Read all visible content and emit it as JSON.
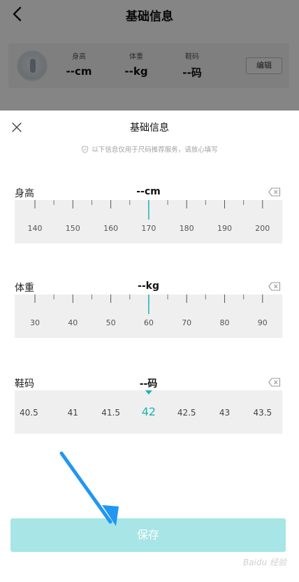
{
  "background_page": {
    "title": "基础信息",
    "stats": [
      {
        "label": "身高",
        "value": "--cm"
      },
      {
        "label": "体重",
        "value": "--kg"
      },
      {
        "label": "鞋码",
        "value": "--码"
      }
    ],
    "edit_label": "编辑"
  },
  "sheet": {
    "title": "基础信息",
    "notice": "以下信息仅用于尺码推荐服务，请放心填写",
    "fields": [
      {
        "label": "身高",
        "value": "--cm",
        "scale": [
          "140",
          "150",
          "160",
          "170",
          "180",
          "190",
          "200"
        ],
        "selected": "170"
      },
      {
        "label": "体重",
        "value": "--kg",
        "scale": [
          "30",
          "40",
          "50",
          "60",
          "70",
          "80",
          "90"
        ],
        "selected": "60"
      },
      {
        "label": "鞋码",
        "value": "--码",
        "scale": [
          "40.5",
          "41",
          "41.5",
          "42",
          "42.5",
          "43",
          "43.5"
        ],
        "selected": "42"
      }
    ],
    "save_label": "保存"
  },
  "watermark": "Baidu 经验",
  "colors": {
    "accent": "#20b2b4",
    "save_button": "#a7e5e6",
    "arrow": "#2196f3"
  },
  "icons": {
    "back": "chevron-left-icon",
    "close": "close-icon",
    "clear": "backspace-icon",
    "notice": "shield-icon"
  }
}
